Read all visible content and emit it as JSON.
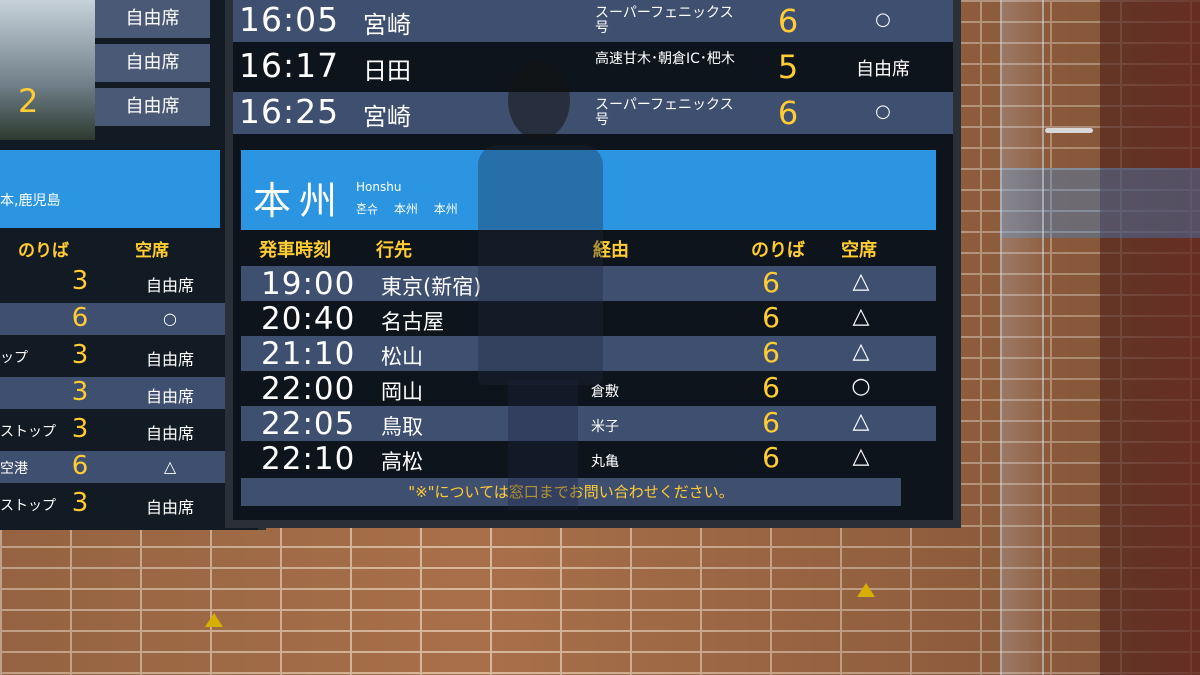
{
  "left_board": {
    "top_cells": [
      "自由席",
      "自由席",
      "自由席"
    ],
    "top_number": "2",
    "band_text": "本,鹿児島",
    "header": {
      "platform": "のりば",
      "seat": "空席"
    },
    "rows": [
      {
        "dest": "",
        "platform": "3",
        "seat": "自由席"
      },
      {
        "dest": "",
        "platform": "6",
        "seat": "○"
      },
      {
        "dest": "ップ",
        "platform": "3",
        "seat": "自由席"
      },
      {
        "dest": "",
        "platform": "3",
        "seat": "自由席"
      },
      {
        "dest": "ストップ",
        "platform": "3",
        "seat": "自由席"
      },
      {
        "dest": "空港",
        "platform": "6",
        "seat": "△"
      },
      {
        "dest": "ストップ",
        "platform": "3",
        "seat": "自由席"
      }
    ]
  },
  "top_rows": [
    {
      "time": "16:05",
      "dest": "宮崎",
      "via": "スーパーフェニックス号",
      "platform": "6",
      "seat": "○"
    },
    {
      "time": "16:17",
      "dest": "日田",
      "via": "高速甘木･朝倉IC･杷木",
      "platform": "5",
      "seat": "自由席"
    },
    {
      "time": "16:25",
      "dest": "宮崎",
      "via": "スーパーフェニックス号",
      "platform": "6",
      "seat": "○"
    }
  ],
  "section": {
    "title": "本州",
    "title_en": "Honshu",
    "title_sub": "혼슈 本州 本州"
  },
  "columns": {
    "time": "発車時刻",
    "dest": "行先",
    "via": "経由",
    "platform": "のりば",
    "seat": "空席"
  },
  "departures": [
    {
      "time": "19:00",
      "dest": "東京(新宿)",
      "via": "",
      "platform": "6",
      "seat": "△"
    },
    {
      "time": "20:40",
      "dest": "名古屋",
      "via": "",
      "platform": "6",
      "seat": "△"
    },
    {
      "time": "21:10",
      "dest": "松山",
      "via": "",
      "platform": "6",
      "seat": "△"
    },
    {
      "time": "22:00",
      "dest": "岡山",
      "via": "倉敷",
      "platform": "6",
      "seat": "○"
    },
    {
      "time": "22:05",
      "dest": "鳥取",
      "via": "米子",
      "platform": "6",
      "seat": "△"
    },
    {
      "time": "22:10",
      "dest": "高松",
      "via": "丸亀",
      "platform": "6",
      "seat": "△"
    }
  ],
  "notice": "\"※\"については窓口までお問い合わせください。"
}
